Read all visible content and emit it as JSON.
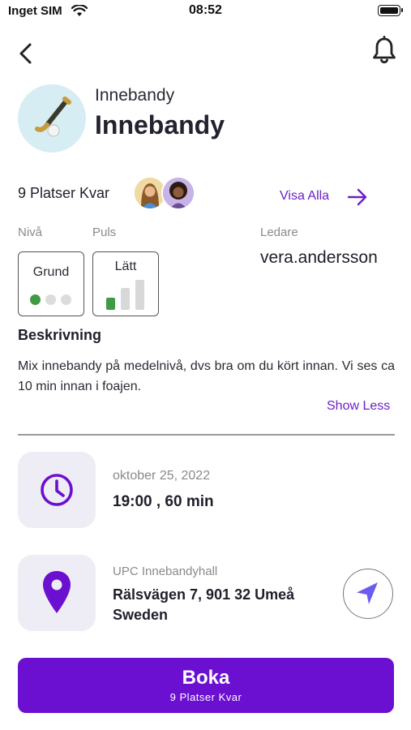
{
  "status_bar": {
    "carrier": "Inget SIM",
    "time": "08:52",
    "icons": [
      "wifi-icon",
      "battery-icon"
    ]
  },
  "header": {
    "back_icon": "chevron-left-icon",
    "notification_icon": "bell-icon"
  },
  "activity": {
    "icon": "hockey-stick-icon",
    "category": "Innebandy",
    "title": "Innebandy",
    "spots_left": "9 Platser Kvar",
    "participants": [
      "participant-1",
      "participant-2"
    ],
    "see_all": "Visa Alla"
  },
  "levels": {
    "niva_label": "Nivå",
    "puls_label": "Puls",
    "ledare_label": "Ledare",
    "niva_value": "Grund",
    "niva_level": 1,
    "niva_max": 3,
    "puls_value": "Lätt",
    "puls_level": 1,
    "puls_max": 3,
    "leader": "vera.andersson"
  },
  "description": {
    "heading": "Beskrivning",
    "text": "Mix innebandy på medelnivå, dvs bra om du kört innan. Vi ses ca 10 min innan i foajen.",
    "toggle": "Show Less"
  },
  "schedule": {
    "icon": "clock-icon",
    "date": "oktober 25, 2022",
    "time": "19:00 , 60 min"
  },
  "location": {
    "icon": "map-pin-icon",
    "venue": "UPC Innebandyhall",
    "address": "Rälsvägen 7, 901 32 Umeå Sweden",
    "nav_icon": "navigation-arrow-icon"
  },
  "booking": {
    "label": "Boka",
    "sub_label": "9 Platser Kvar"
  },
  "colors": {
    "accent": "#6b0fd0",
    "green": "#3f9a45",
    "tile_bg": "#eeedf5",
    "avatar_bg": "#d5edf3"
  }
}
